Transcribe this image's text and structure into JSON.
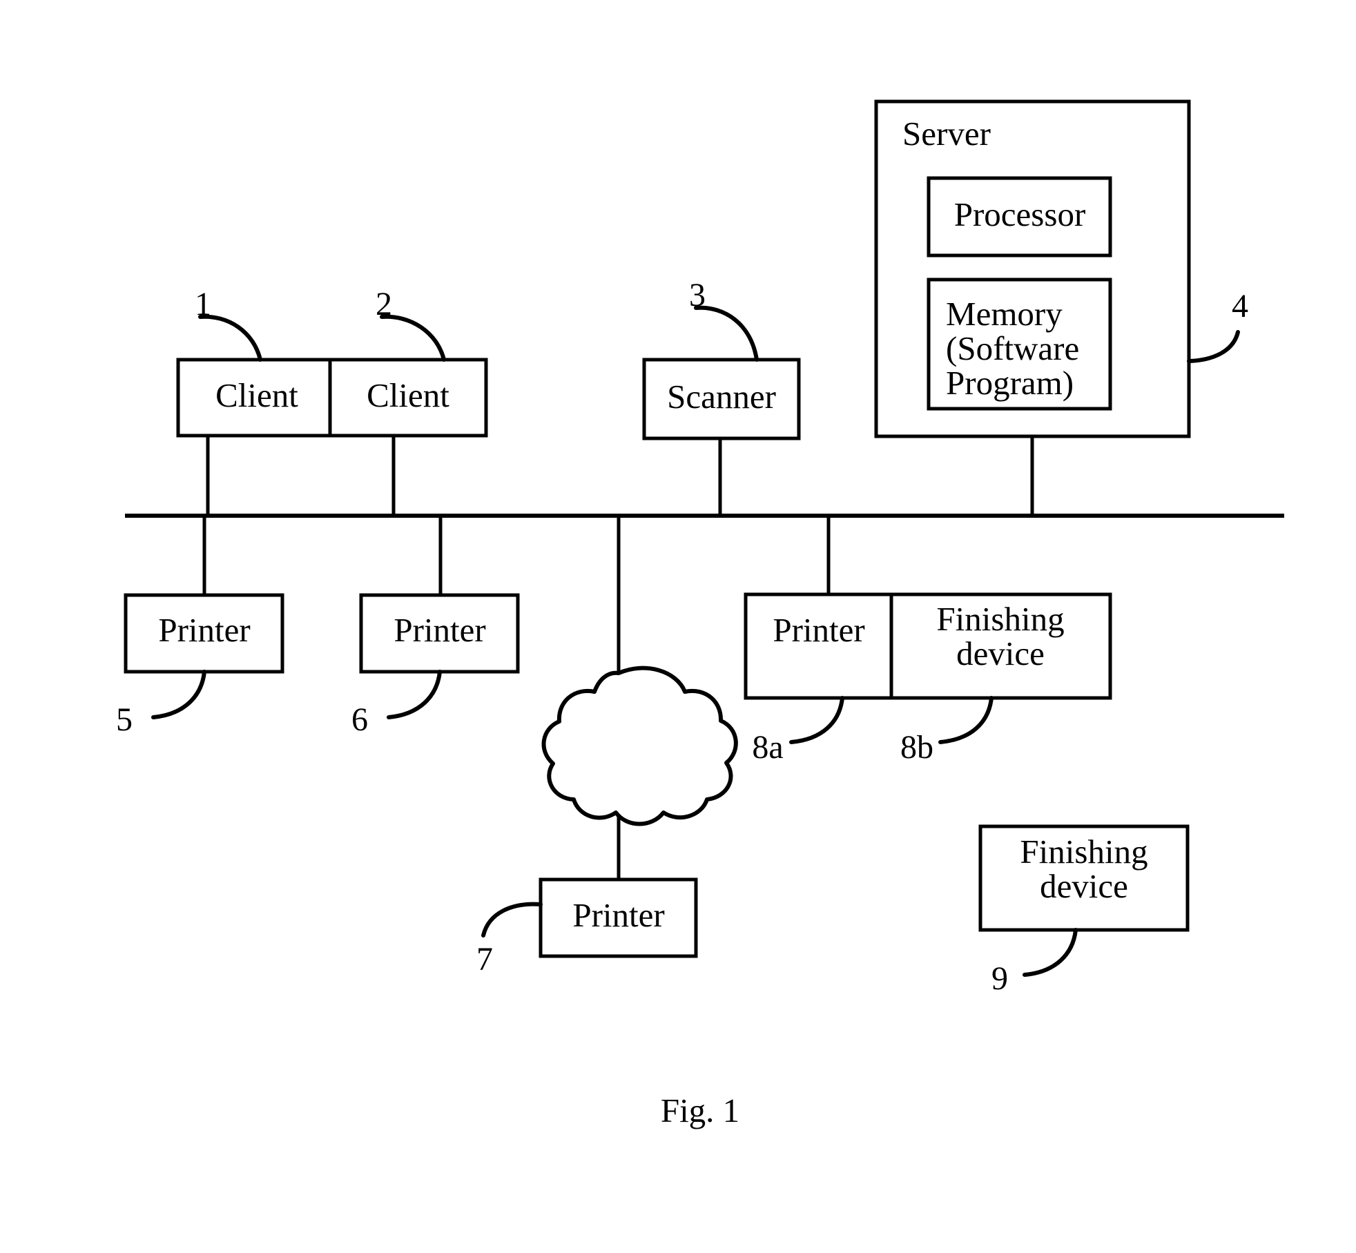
{
  "figure": {
    "caption": "Fig. 1",
    "type": "patent-network-diagram"
  },
  "nodes": {
    "client_1": {
      "label": "Client",
      "ref": "1"
    },
    "client_2": {
      "label": "Client",
      "ref": "2"
    },
    "scanner_3": {
      "label": "Scanner",
      "ref": "3"
    },
    "server_4": {
      "label": "Server",
      "ref": "4",
      "processor": "Processor",
      "memory_line_1": "Memory",
      "memory_line_2": "(Software",
      "memory_line_3": "Program)"
    },
    "printer_5": {
      "label": "Printer",
      "ref": "5"
    },
    "printer_6": {
      "label": "Printer",
      "ref": "6"
    },
    "printer_7": {
      "label": "Printer",
      "ref": "7"
    },
    "printer_8a": {
      "label": "Printer",
      "ref": "8a"
    },
    "finishing_8b": {
      "label_line_1": "Finishing",
      "label_line_2": "device",
      "ref": "8b"
    },
    "finishing_9": {
      "label_line_1": "Finishing",
      "label_line_2": "device",
      "ref": "9"
    },
    "network_cloud": {
      "label": "",
      "ref": ""
    }
  },
  "colors": {
    "ink": "#000000",
    "paper": "#ffffff"
  }
}
